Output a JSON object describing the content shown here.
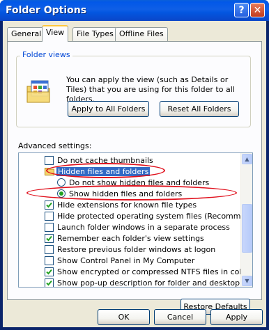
{
  "window": {
    "title": "Folder Options",
    "help_glyph": "?",
    "close_glyph": "✕"
  },
  "tabs": [
    {
      "label": "General",
      "active": false
    },
    {
      "label": "View",
      "active": true
    },
    {
      "label": "File Types",
      "active": false
    },
    {
      "label": "Offline Files",
      "active": false
    }
  ],
  "folder_views": {
    "title": "Folder views",
    "description": "You can apply the view (such as Details or Tiles) that you are using for this folder to all folders.",
    "apply_all_label": "Apply to All Folders",
    "reset_all_label": "Reset All Folders"
  },
  "advanced": {
    "label": "Advanced settings:",
    "items": [
      {
        "type": "checkbox",
        "label": "Do not cache thumbnails",
        "checked": false,
        "indent": 1
      },
      {
        "type": "folder",
        "label": "Hidden files and folders",
        "selected": true,
        "indent": 1
      },
      {
        "type": "radio",
        "label": "Do not show hidden files and folders",
        "checked": false,
        "indent": 2
      },
      {
        "type": "radio",
        "label": "Show hidden files and folders",
        "checked": true,
        "indent": 2
      },
      {
        "type": "checkbox",
        "label": "Hide extensions for known file types",
        "checked": true,
        "indent": 1
      },
      {
        "type": "checkbox",
        "label": "Hide protected operating system files (Recommended)",
        "checked": false,
        "indent": 1
      },
      {
        "type": "checkbox",
        "label": "Launch folder windows in a separate process",
        "checked": false,
        "indent": 1
      },
      {
        "type": "checkbox",
        "label": "Remember each folder's view settings",
        "checked": true,
        "indent": 1
      },
      {
        "type": "checkbox",
        "label": "Restore previous folder windows at logon",
        "checked": false,
        "indent": 1
      },
      {
        "type": "checkbox",
        "label": "Show Control Panel in My Computer",
        "checked": false,
        "indent": 1
      },
      {
        "type": "checkbox",
        "label": "Show encrypted or compressed NTFS files in color",
        "checked": true,
        "indent": 1
      },
      {
        "type": "checkbox",
        "label": "Show pop-up description for folder and desktop items",
        "checked": true,
        "indent": 1
      }
    ],
    "restore_defaults_label": "Restore Defaults"
  },
  "footer": {
    "ok_label": "OK",
    "cancel_label": "Cancel",
    "apply_label": "Apply"
  },
  "colors": {
    "selection": "#316ac5",
    "annotation": "#e0101c",
    "group_title": "#0046d5"
  }
}
